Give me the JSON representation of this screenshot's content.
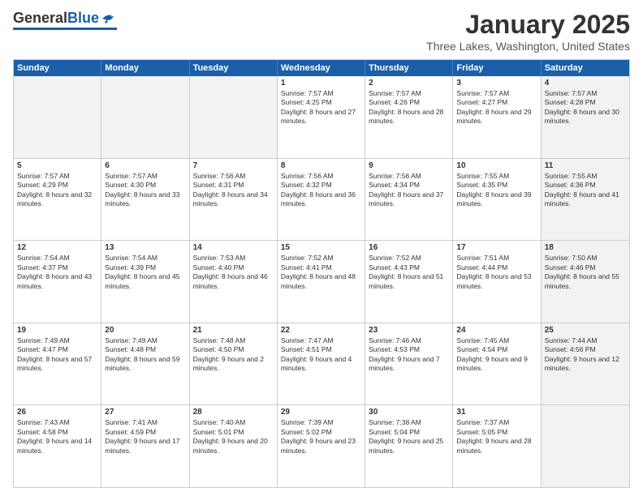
{
  "logo": {
    "general": "General",
    "blue": "Blue"
  },
  "title": {
    "month": "January 2025",
    "location": "Three Lakes, Washington, United States"
  },
  "calendar": {
    "headers": [
      "Sunday",
      "Monday",
      "Tuesday",
      "Wednesday",
      "Thursday",
      "Friday",
      "Saturday"
    ],
    "rows": [
      [
        {
          "day": "",
          "text": "",
          "shaded": true
        },
        {
          "day": "",
          "text": "",
          "shaded": true
        },
        {
          "day": "",
          "text": "",
          "shaded": true
        },
        {
          "day": "1",
          "text": "Sunrise: 7:57 AM\nSunset: 4:25 PM\nDaylight: 8 hours and 27 minutes.",
          "shaded": false
        },
        {
          "day": "2",
          "text": "Sunrise: 7:57 AM\nSunset: 4:26 PM\nDaylight: 8 hours and 28 minutes.",
          "shaded": false
        },
        {
          "day": "3",
          "text": "Sunrise: 7:57 AM\nSunset: 4:27 PM\nDaylight: 8 hours and 29 minutes.",
          "shaded": false
        },
        {
          "day": "4",
          "text": "Sunrise: 7:57 AM\nSunset: 4:28 PM\nDaylight: 8 hours and 30 minutes.",
          "shaded": true
        }
      ],
      [
        {
          "day": "5",
          "text": "Sunrise: 7:57 AM\nSunset: 4:29 PM\nDaylight: 8 hours and 32 minutes.",
          "shaded": false
        },
        {
          "day": "6",
          "text": "Sunrise: 7:57 AM\nSunset: 4:30 PM\nDaylight: 8 hours and 33 minutes.",
          "shaded": false
        },
        {
          "day": "7",
          "text": "Sunrise: 7:56 AM\nSunset: 4:31 PM\nDaylight: 8 hours and 34 minutes.",
          "shaded": false
        },
        {
          "day": "8",
          "text": "Sunrise: 7:56 AM\nSunset: 4:32 PM\nDaylight: 8 hours and 36 minutes.",
          "shaded": false
        },
        {
          "day": "9",
          "text": "Sunrise: 7:56 AM\nSunset: 4:34 PM\nDaylight: 8 hours and 37 minutes.",
          "shaded": false
        },
        {
          "day": "10",
          "text": "Sunrise: 7:55 AM\nSunset: 4:35 PM\nDaylight: 8 hours and 39 minutes.",
          "shaded": false
        },
        {
          "day": "11",
          "text": "Sunrise: 7:55 AM\nSunset: 4:36 PM\nDaylight: 8 hours and 41 minutes.",
          "shaded": true
        }
      ],
      [
        {
          "day": "12",
          "text": "Sunrise: 7:54 AM\nSunset: 4:37 PM\nDaylight: 8 hours and 43 minutes.",
          "shaded": false
        },
        {
          "day": "13",
          "text": "Sunrise: 7:54 AM\nSunset: 4:39 PM\nDaylight: 8 hours and 45 minutes.",
          "shaded": false
        },
        {
          "day": "14",
          "text": "Sunrise: 7:53 AM\nSunset: 4:40 PM\nDaylight: 8 hours and 46 minutes.",
          "shaded": false
        },
        {
          "day": "15",
          "text": "Sunrise: 7:52 AM\nSunset: 4:41 PM\nDaylight: 8 hours and 48 minutes.",
          "shaded": false
        },
        {
          "day": "16",
          "text": "Sunrise: 7:52 AM\nSunset: 4:43 PM\nDaylight: 8 hours and 51 minutes.",
          "shaded": false
        },
        {
          "day": "17",
          "text": "Sunrise: 7:51 AM\nSunset: 4:44 PM\nDaylight: 8 hours and 53 minutes.",
          "shaded": false
        },
        {
          "day": "18",
          "text": "Sunrise: 7:50 AM\nSunset: 4:46 PM\nDaylight: 8 hours and 55 minutes.",
          "shaded": true
        }
      ],
      [
        {
          "day": "19",
          "text": "Sunrise: 7:49 AM\nSunset: 4:47 PM\nDaylight: 8 hours and 57 minutes.",
          "shaded": false
        },
        {
          "day": "20",
          "text": "Sunrise: 7:49 AM\nSunset: 4:48 PM\nDaylight: 8 hours and 59 minutes.",
          "shaded": false
        },
        {
          "day": "21",
          "text": "Sunrise: 7:48 AM\nSunset: 4:50 PM\nDaylight: 9 hours and 2 minutes.",
          "shaded": false
        },
        {
          "day": "22",
          "text": "Sunrise: 7:47 AM\nSunset: 4:51 PM\nDaylight: 9 hours and 4 minutes.",
          "shaded": false
        },
        {
          "day": "23",
          "text": "Sunrise: 7:46 AM\nSunset: 4:53 PM\nDaylight: 9 hours and 7 minutes.",
          "shaded": false
        },
        {
          "day": "24",
          "text": "Sunrise: 7:45 AM\nSunset: 4:54 PM\nDaylight: 9 hours and 9 minutes.",
          "shaded": false
        },
        {
          "day": "25",
          "text": "Sunrise: 7:44 AM\nSunset: 4:56 PM\nDaylight: 9 hours and 12 minutes.",
          "shaded": true
        }
      ],
      [
        {
          "day": "26",
          "text": "Sunrise: 7:43 AM\nSunset: 4:58 PM\nDaylight: 9 hours and 14 minutes.",
          "shaded": false
        },
        {
          "day": "27",
          "text": "Sunrise: 7:41 AM\nSunset: 4:59 PM\nDaylight: 9 hours and 17 minutes.",
          "shaded": false
        },
        {
          "day": "28",
          "text": "Sunrise: 7:40 AM\nSunset: 5:01 PM\nDaylight: 9 hours and 20 minutes.",
          "shaded": false
        },
        {
          "day": "29",
          "text": "Sunrise: 7:39 AM\nSunset: 5:02 PM\nDaylight: 9 hours and 23 minutes.",
          "shaded": false
        },
        {
          "day": "30",
          "text": "Sunrise: 7:38 AM\nSunset: 5:04 PM\nDaylight: 9 hours and 25 minutes.",
          "shaded": false
        },
        {
          "day": "31",
          "text": "Sunrise: 7:37 AM\nSunset: 5:05 PM\nDaylight: 9 hours and 28 minutes.",
          "shaded": false
        },
        {
          "day": "",
          "text": "",
          "shaded": true
        }
      ]
    ]
  }
}
